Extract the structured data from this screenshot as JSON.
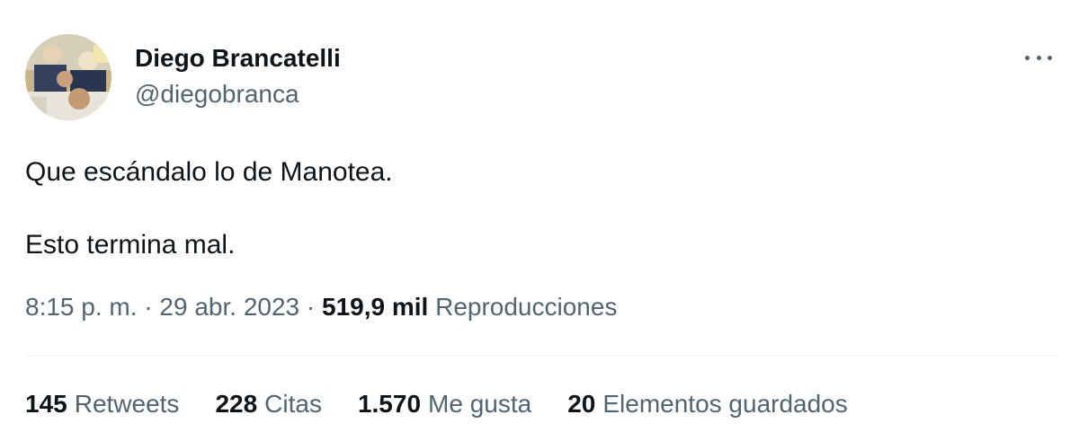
{
  "author": {
    "display_name": "Diego Brancatelli",
    "handle": "@diegobranca",
    "avatar_icon": "profile-photo"
  },
  "more_icon": "more-options-icon",
  "tweet": {
    "line1": "Que escándalo lo de Manotea.",
    "line2": "Esto termina mal."
  },
  "meta": {
    "time": "8:15 p. m.",
    "sep1": " · ",
    "date": "29 abr. 2023",
    "sep2": " · ",
    "views_count": "519,9 mil",
    "views_label": "Reproducciones"
  },
  "stats": {
    "retweets_count": "145",
    "retweets_label": "Retweets",
    "quotes_count": "228",
    "quotes_label": "Citas",
    "likes_count": "1.570",
    "likes_label": "Me gusta",
    "bookmarks_count": "20",
    "bookmarks_label": "Elementos guardados"
  },
  "colors": {
    "text_primary": "#0f1419",
    "text_secondary": "#536471",
    "divider": "#eff3f4"
  }
}
